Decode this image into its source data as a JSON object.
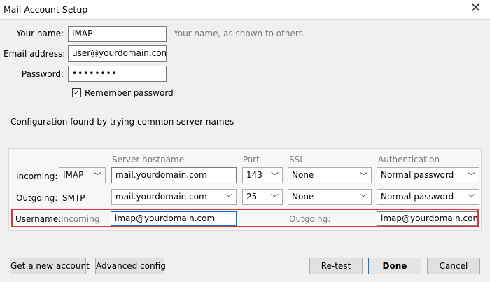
{
  "window": {
    "title": "Mail Account Setup",
    "close_glyph": "✕"
  },
  "form": {
    "name_label": "Your name:",
    "name_value": "IMAP",
    "name_hint": "Your name, as shown to others",
    "email_label": "Email address:",
    "email_value": "user@yourdomain.com",
    "password_label": "Password:",
    "password_value": "••••••••",
    "remember_label": "Remember password",
    "remember_checked": "✓"
  },
  "status": {
    "message": "Configuration found by trying common server names"
  },
  "config": {
    "headers": {
      "hostname": "Server hostname",
      "port": "Port",
      "ssl": "SSL",
      "auth": "Authentication"
    },
    "incoming": {
      "label": "Incoming:",
      "protocol": "IMAP",
      "hostname": "mail.yourdomain.com",
      "port": "143",
      "ssl": "None",
      "auth": "Normal password"
    },
    "outgoing": {
      "label": "Outgoing:",
      "protocol": "SMTP",
      "hostname": "mail.yourdomain.com",
      "port": "25",
      "ssl": "None",
      "auth": "Normal password"
    },
    "username": {
      "label": "Username:",
      "incoming_label": "Incoming:",
      "incoming_value": "imap@yourdomain.com",
      "outgoing_label": "Outgoing:",
      "outgoing_value": "imap@yourdomain.com"
    }
  },
  "buttons": {
    "new_account": "Get a new account",
    "advanced": "Advanced config",
    "retest": "Re-test",
    "done": "Done",
    "cancel": "Cancel"
  },
  "glyphs": {
    "dropdown": "﹀"
  },
  "colors": {
    "highlight_border": "#d9373a",
    "default_button_border": "#0078d7"
  }
}
